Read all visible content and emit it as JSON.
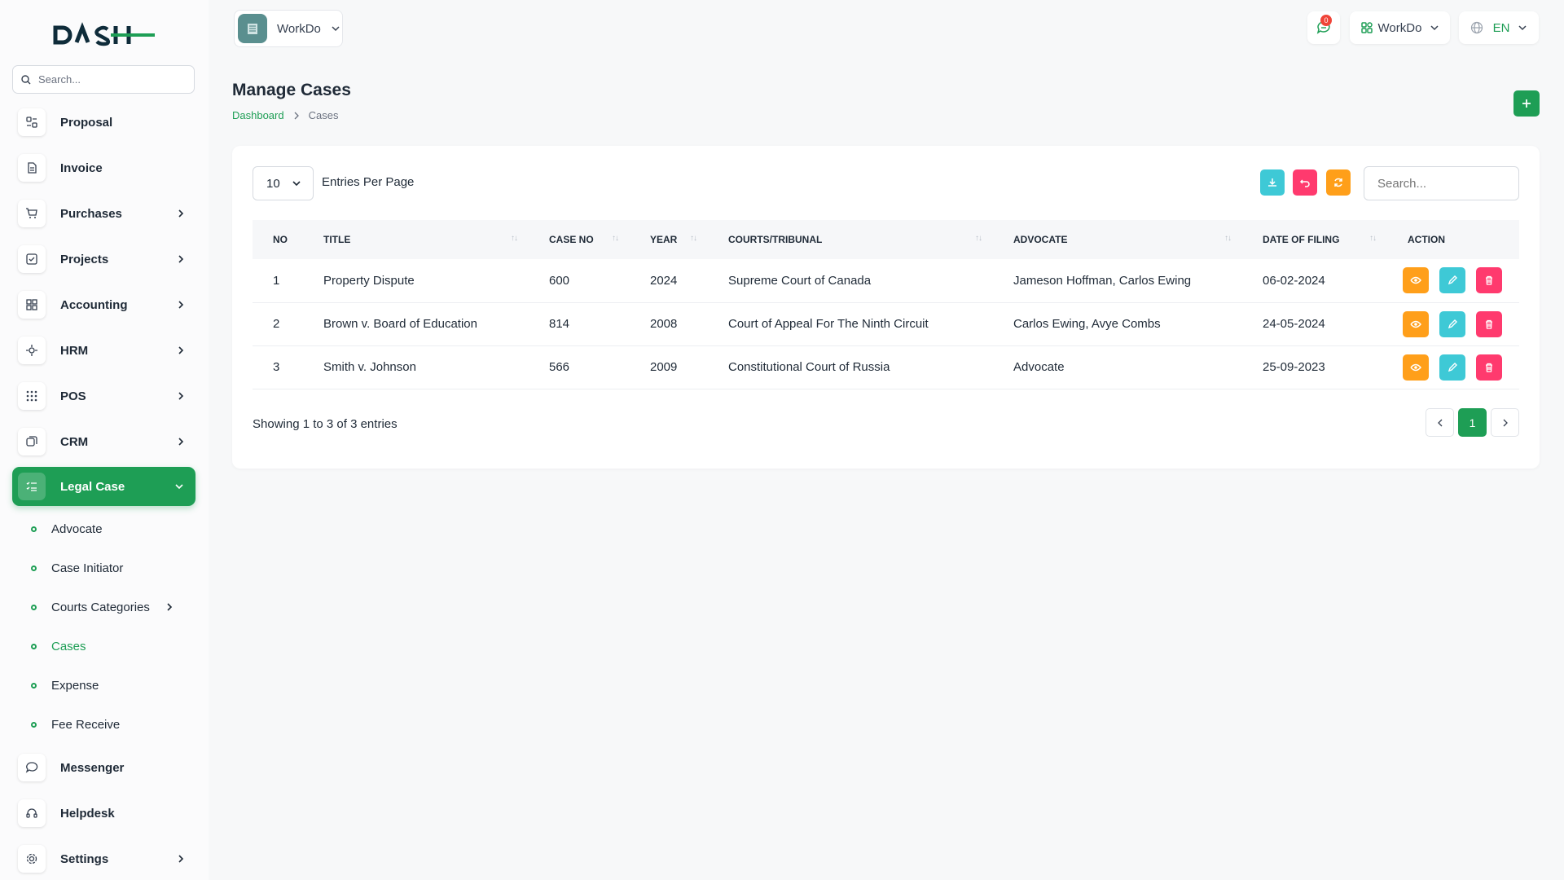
{
  "sidebar": {
    "logo_text": "DASH",
    "search_placeholder": "Search...",
    "items": [
      {
        "label": "Proposal",
        "icon": "proposal-icon"
      },
      {
        "label": "Invoice",
        "icon": "invoice-icon"
      },
      {
        "label": "Purchases",
        "icon": "cart-icon"
      },
      {
        "label": "Projects",
        "icon": "checkbox-icon"
      },
      {
        "label": "Accounting",
        "icon": "grid-icon"
      },
      {
        "label": "HRM",
        "icon": "hrm-icon"
      },
      {
        "label": "POS",
        "icon": "dots-grid-icon"
      },
      {
        "label": "CRM",
        "icon": "crm-icon"
      },
      {
        "label": "Legal Case",
        "icon": "list-icon"
      },
      {
        "label": "Messenger",
        "icon": "chat-icon"
      },
      {
        "label": "Helpdesk",
        "icon": "headset-icon"
      },
      {
        "label": "Settings",
        "icon": "gear-icon"
      }
    ],
    "legal_sub": [
      "Advocate",
      "Case Initiator",
      "Courts Categories",
      "Cases",
      "Expense",
      "Fee Receive"
    ]
  },
  "topbar": {
    "workspace": "WorkDo",
    "notif_count": "0",
    "user_menu": "WorkDo",
    "language": "EN"
  },
  "header": {
    "title": "Manage Cases",
    "breadcrumb": [
      "Dashboard",
      "Cases"
    ]
  },
  "table": {
    "per_page": "10",
    "per_page_label": "Entries Per Page",
    "search_placeholder": "Search...",
    "columns": [
      "NO",
      "TITLE",
      "CASE NO",
      "YEAR",
      "COURTS/TRIBUNAL",
      "ADVOCATE",
      "DATE OF FILING",
      "ACTION"
    ],
    "rows": [
      {
        "no": "1",
        "title": "Property Dispute",
        "case_no": "600",
        "year": "2024",
        "court": "Supreme Court of Canada",
        "advocate": "Jameson Hoffman, Carlos Ewing",
        "date": "06-02-2024"
      },
      {
        "no": "2",
        "title": "Brown v. Board of Education",
        "case_no": "814",
        "year": "2008",
        "court": "Court of Appeal For The Ninth Circuit",
        "advocate": "Carlos Ewing, Avye Combs",
        "date": "24-05-2024"
      },
      {
        "no": "3",
        "title": "Smith v. Johnson",
        "case_no": "566",
        "year": "2009",
        "court": "Constitutional Court of Russia",
        "advocate": "Advocate",
        "date": "25-09-2023"
      }
    ],
    "showing": "Showing 1 to 3 of 3 entries",
    "current_page": "1"
  },
  "colors": {
    "accent": "#1e9e55",
    "view": "#ff9f1a",
    "edit": "#3ec9d6",
    "delete": "#ff3a6e"
  }
}
